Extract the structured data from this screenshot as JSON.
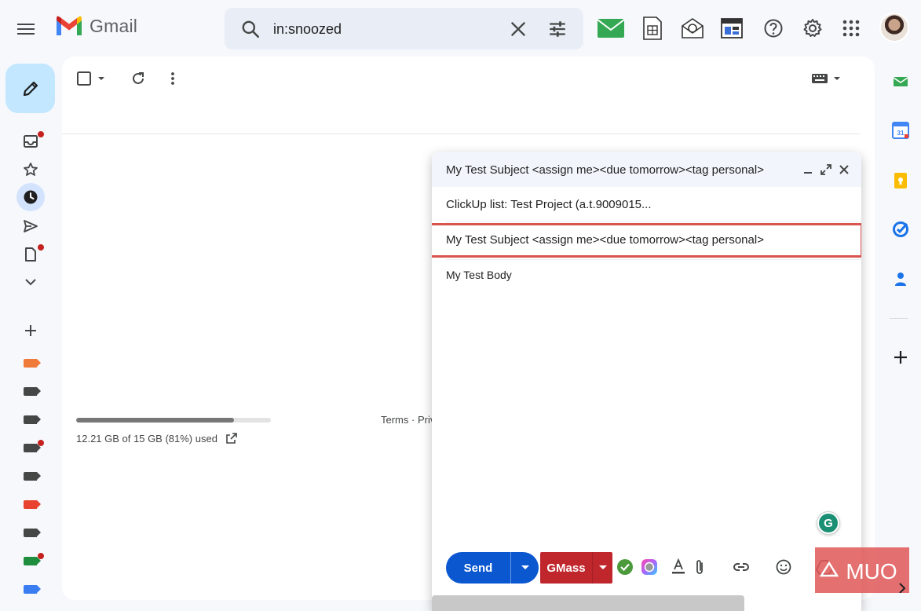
{
  "app": {
    "name": "Gmail"
  },
  "search": {
    "value": "in:snoozed"
  },
  "storage": {
    "text": "12.21 GB of 15 GB (81%) used",
    "fraction": 0.81
  },
  "footer": {
    "links": "Terms · Priv"
  },
  "labels": [
    {
      "color": "#f07a3a",
      "dot": false
    },
    {
      "color": "#444746",
      "dot": false
    },
    {
      "color": "#444746",
      "dot": false
    },
    {
      "color": "#444746",
      "dot": true
    },
    {
      "color": "#444746",
      "dot": false
    },
    {
      "color": "#e8432f",
      "dot": false
    },
    {
      "color": "#444746",
      "dot": false
    },
    {
      "color": "#1e8e3e",
      "dot": true
    },
    {
      "color": "#3a7df0",
      "dot": false
    }
  ],
  "compose": {
    "title": "My Test Subject <assign me><due tomorrow><tag personal>",
    "to": "ClickUp list: Test Project (a.t.9009015...",
    "subject": "My Test Subject <assign me><due tomorrow><tag personal>",
    "body": "My Test Body",
    "send_label": "Send",
    "gmass_label": "GMass"
  },
  "colors": {
    "accent": "#0b57d0",
    "compose_btn": "#c2e7ff",
    "gmass": "#c0272d",
    "highlight": "#d9534f"
  },
  "watermark": {
    "text": "MUO"
  }
}
